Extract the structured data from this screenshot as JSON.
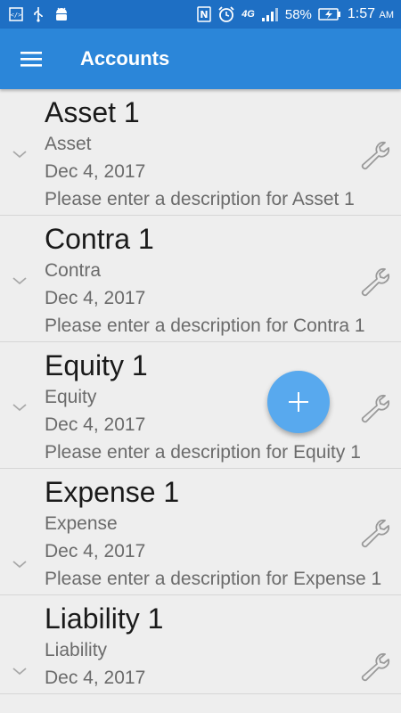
{
  "status_bar": {
    "battery": "58%",
    "time": "1:57",
    "ampm": "AM",
    "network_label": "4G"
  },
  "toolbar": {
    "title": "Accounts",
    "color": "#2b86d9"
  },
  "fab": {
    "color": "#58a9ee",
    "icon": "plus-icon"
  },
  "accounts": [
    {
      "name": "Asset 1",
      "type": "Asset",
      "date": "Dec 4, 2017",
      "description": "Please enter a description for Asset 1"
    },
    {
      "name": "Contra 1",
      "type": "Contra",
      "date": "Dec 4, 2017",
      "description": "Please enter a description for Contra 1"
    },
    {
      "name": "Equity 1",
      "type": "Equity",
      "date": "Dec 4, 2017",
      "description": "Please enter a description for Equity 1"
    },
    {
      "name": "Expense 1",
      "type": "Expense",
      "date": "Dec 4, 2017",
      "description": "Please enter a description for Expense 1"
    },
    {
      "name": "Liability 1",
      "type": "Liability",
      "date": "Dec 4, 2017",
      "description": ""
    }
  ]
}
